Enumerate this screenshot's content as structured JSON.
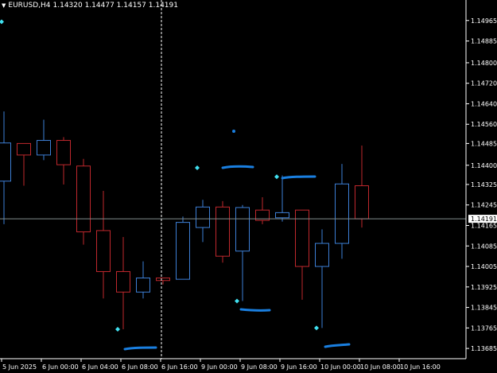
{
  "header": {
    "menu_icon": "triangle-down-icon",
    "symbol": "EURUSD,H4",
    "ohlc": "1.14320 1.14477 1.14157 1.14191"
  },
  "colors": {
    "background": "#000000",
    "bull": "#3d7fd6",
    "bear": "#c0282d",
    "axis": "#ffffff",
    "bid_line": "#7f8c8d",
    "marker": "#40e0f0",
    "drawing": "#1a7fe0"
  },
  "current_price": "1.14191",
  "chart_data": {
    "type": "candlestick",
    "symbol": "EURUSD",
    "timeframe": "H4",
    "ylim": [
      1.13645,
      1.15045
    ],
    "y_ticks": [
      "1.14965",
      "1.14885",
      "1.14800",
      "1.14720",
      "1.14640",
      "1.14560",
      "1.14485",
      "1.14400",
      "1.14325",
      "1.14245",
      "1.14165",
      "1.14085",
      "1.14005",
      "1.13925",
      "1.13845",
      "1.13765",
      "1.13685"
    ],
    "time_labels": [
      "5 Jun 2025",
      "6 Jun 00:00",
      "6 Jun 04:00",
      "6 Jun 08:00",
      "6 Jun 16:00",
      "9 Jun 00:00",
      "9 Jun 08:00",
      "9 Jun 16:00",
      "10 Jun 00:00",
      "10 Jun 08:00",
      "10 Jun 16:00"
    ],
    "candles": [
      {
        "o": 1.14338,
        "h": 1.1461,
        "l": 1.1417,
        "c": 1.14487
      },
      {
        "o": 1.14485,
        "h": 1.14485,
        "l": 1.1432,
        "c": 1.1444
      },
      {
        "o": 1.1444,
        "h": 1.14578,
        "l": 1.1442,
        "c": 1.14497
      },
      {
        "o": 1.14497,
        "h": 1.1451,
        "l": 1.14325,
        "c": 1.14402
      },
      {
        "o": 1.14397,
        "h": 1.14425,
        "l": 1.1409,
        "c": 1.1414
      },
      {
        "o": 1.14145,
        "h": 1.143,
        "l": 1.1388,
        "c": 1.13985
      },
      {
        "o": 1.13985,
        "h": 1.1412,
        "l": 1.1376,
        "c": 1.13905
      },
      {
        "o": 1.13905,
        "h": 1.14025,
        "l": 1.1388,
        "c": 1.1396
      },
      {
        "o": 1.1396,
        "h": 1.1396,
        "l": 1.13935,
        "c": 1.1395
      },
      {
        "o": 1.13955,
        "h": 1.142,
        "l": 1.13955,
        "c": 1.14177
      },
      {
        "o": 1.14157,
        "h": 1.14265,
        "l": 1.141,
        "c": 1.14237
      },
      {
        "o": 1.14237,
        "h": 1.1426,
        "l": 1.1402,
        "c": 1.14045
      },
      {
        "o": 1.14065,
        "h": 1.14245,
        "l": 1.1387,
        "c": 1.14235
      },
      {
        "o": 1.14225,
        "h": 1.14275,
        "l": 1.1417,
        "c": 1.14185
      },
      {
        "o": 1.14195,
        "h": 1.1436,
        "l": 1.1418,
        "c": 1.14215
      },
      {
        "o": 1.14225,
        "h": 1.14225,
        "l": 1.13875,
        "c": 1.14005
      },
      {
        "o": 1.14005,
        "h": 1.1415,
        "l": 1.13765,
        "c": 1.14095
      },
      {
        "o": 1.14095,
        "h": 1.14405,
        "l": 1.14035,
        "c": 1.14327
      },
      {
        "o": 1.1432,
        "h": 1.14477,
        "l": 1.14157,
        "c": 1.14191
      }
    ],
    "fractal_markers": [
      {
        "candle": 0,
        "price": 1.1496
      },
      {
        "candle": 6,
        "price": 1.1376
      },
      {
        "candle": 10,
        "price": 1.1439
      },
      {
        "candle": 12,
        "price": 1.1387
      },
      {
        "candle": 14,
        "price": 1.14355
      },
      {
        "candle": 16,
        "price": 1.13765
      }
    ],
    "grid": false
  }
}
